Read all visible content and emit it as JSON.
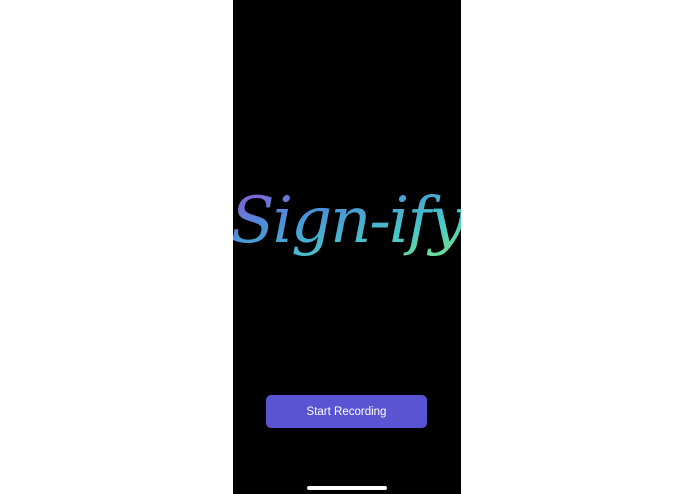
{
  "app": {
    "logo_text": "Sign-ify"
  },
  "actions": {
    "start_recording_label": "Start Recording"
  },
  "colors": {
    "background": "#000000",
    "button": "#5a54d2",
    "logo_gradient": [
      "#8a4fd0",
      "#4a8fd8",
      "#4fd2c8",
      "#7be08a"
    ]
  }
}
